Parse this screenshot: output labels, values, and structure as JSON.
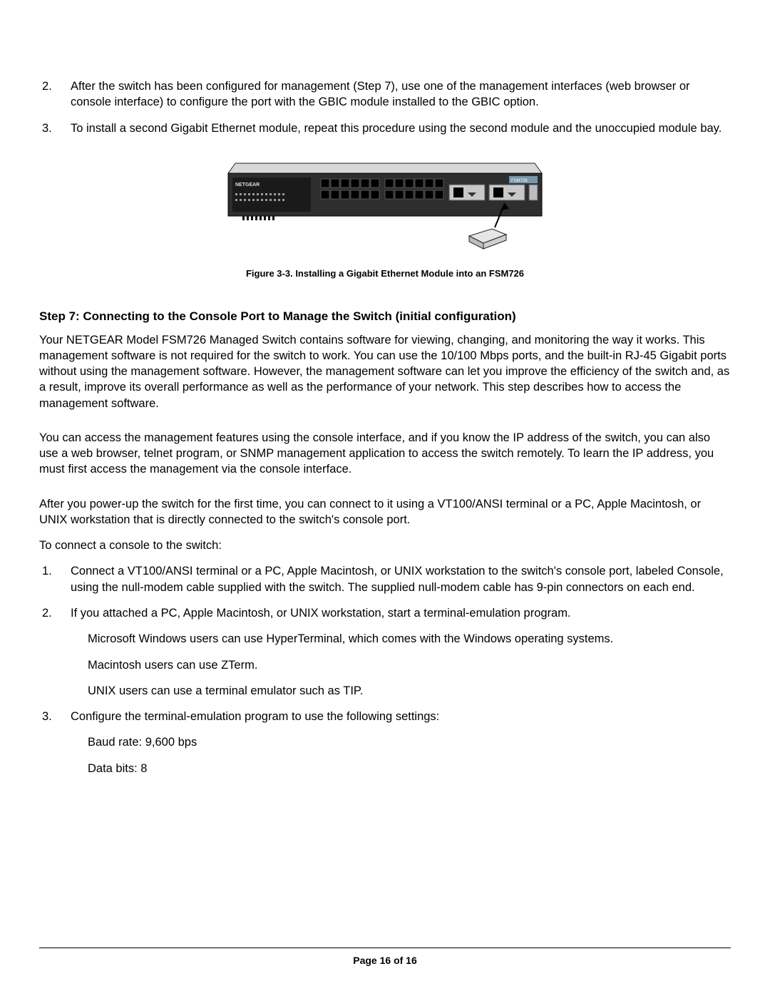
{
  "list_top": [
    {
      "num": "2.",
      "text": "After the switch has been configured for management (Step 7), use one of the management interfaces (web browser or console interface) to configure the port with the GBIC module installed to the GBIC option."
    },
    {
      "num": "3.",
      "text": "To install a second Gigabit Ethernet module, repeat this procedure using the second module and the unoccupied module bay."
    }
  ],
  "figure_caption": "Figure 3-3. Installing a Gigabit Ethernet Module into an FSM726",
  "heading": "Step 7: Connecting to the Console Port to Manage the Switch (initial configuration)",
  "para1": "Your NETGEAR Model FSM726 Managed Switch contains software for viewing, changing, and monitoring the way it works. This management software is not required for the switch to work.  You can use the 10/100 Mbps ports, and the built-in RJ-45 Gigabit ports without using the management software.  However, the management software can let you improve the efficiency of the switch and, as a result, improve its overall performance as well as the performance of your network. This step describes how to access the management software.",
  "para2": "You can access the management features using the console interface, and if you know the IP address of the switch, you can also use a web browser, telnet program, or SNMP management application to access the switch remotely.  To learn the IP address, you must first access the management via the console interface.",
  "para3": "After you power-up the switch for the first time, you can connect to it using a VT100/ANSI terminal or a PC, Apple Macintosh, or UNIX workstation that is directly connected to the switch's console port.",
  "para4": "To connect a console to the switch:",
  "list_bottom": [
    {
      "num": "1.",
      "text": "Connect a VT100/ANSI terminal or a PC, Apple Macintosh, or UNIX workstation to the switch's console port, labeled Console, using the null-modem cable supplied with the switch. The supplied null-modem cable has 9-pin connectors on each end."
    },
    {
      "num": "2.",
      "text": " If you attached a PC, Apple Macintosh, or UNIX workstation, start a terminal-emulation program."
    }
  ],
  "sub_after_2": [
    "Microsoft Windows users can use HyperTerminal, which comes with the Windows operating systems.",
    "Macintosh users can use ZTerm.",
    "UNIX users can use a terminal emulator such as TIP."
  ],
  "item3": {
    "num": "3.",
    "text": "Configure the terminal-emulation program to use the following settings:"
  },
  "sub_after_3": [
    "Baud rate: 9,600 bps",
    "Data bits: 8"
  ],
  "footer": "Page 16 of 16",
  "svg_label_brand": "NETGEAR",
  "svg_label_model": "FSM726"
}
